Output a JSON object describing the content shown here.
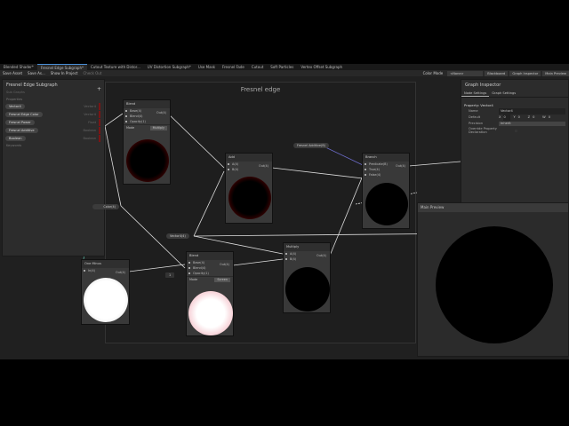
{
  "tabs": [
    "Blended Shader*",
    "Fresnel Edge Subgraph*",
    "Cutout Texture with Distor...",
    "UV Distortion Subgraph*",
    "Use Mask",
    "Fresnel Fade",
    "Cutout",
    "Soft Particles",
    "Vertex Offset Subgraph"
  ],
  "toolbar": {
    "save": "Save Asset",
    "save_as": "Save As...",
    "show": "Show In Project",
    "checkout": "Check Out",
    "color_mode_label": "Color Mode",
    "color_mode": "<None>",
    "blackboard": "Blackboard",
    "inspector": "Graph Inspector",
    "preview": "Main Preview"
  },
  "blackboard": {
    "title": "Fresnel Edge Subgraph",
    "subtitle": "Sub Graphs",
    "section": "Properties",
    "keywords": "Keywords",
    "properties": [
      {
        "name": "Vector4",
        "type": "Vector4"
      },
      {
        "name": "Fresnel Edge Color",
        "type": "Vector4"
      },
      {
        "name": "Fresnel Power",
        "type": "Float"
      },
      {
        "name": "Fresnel Additive",
        "type": "Boolean"
      },
      {
        "name": "Boolean",
        "type": "Boolean"
      }
    ]
  },
  "frame_title": "Fresnel edge",
  "inspector": {
    "title": "Graph Inspector",
    "tab1": "Node Settings",
    "tab2": "Graph Settings",
    "property": "Property: Vector4",
    "name_label": "Name",
    "name_value": "Vector4",
    "default_label": "Default",
    "x": "0",
    "y": "0",
    "z": "0",
    "w": "0",
    "precision_label": "Precision",
    "precision": "Inherit",
    "override_label": "Override Property Declaration"
  },
  "main_preview": "Main Preview",
  "nodes": {
    "blend1": {
      "title": "Blend",
      "base": "Base(4)",
      "blend": "Blend(4)",
      "opacity": "Opacity(1)",
      "out": "Out(4)",
      "mode_label": "Mode",
      "mode": "Multiply"
    },
    "add": {
      "title": "Add",
      "a": "A(4)",
      "b": "B(4)",
      "out": "Out(4)"
    },
    "branch": {
      "title": "Branch",
      "pred": "Predicate(B)",
      "t": "True(4)",
      "f": "False(4)",
      "out": "Out(4)"
    },
    "oneminus": {
      "title": "One Minus",
      "in": "In(4)",
      "out": "Out(4)"
    },
    "blend2": {
      "title": "Blend",
      "base": "Base(4)",
      "blend": "Blend(4)",
      "opacity": "Opacity(1)",
      "out": "Out(4)",
      "mode_label": "Mode",
      "mode": "Screen",
      "opacity_value": "1"
    },
    "multiply": {
      "title": "Multiply",
      "a": "A(4)",
      "b": "B(4)",
      "out": "Out(4)"
    }
  },
  "chips": {
    "vector4": "Vector4(4)",
    "fresnel_additive": "Fresnel Additive(B)",
    "color": "Color(4)"
  }
}
